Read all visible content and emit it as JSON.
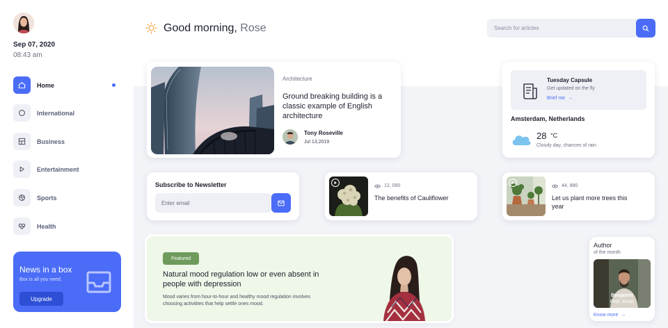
{
  "user": {
    "date": "Sep 07, 2020",
    "time": "08:43 am",
    "greeting": "Good morning,",
    "name": "Rose"
  },
  "sidebar": {
    "items": [
      {
        "label": "Home",
        "icon": "home-icon",
        "active": true
      },
      {
        "label": "International",
        "icon": "circle-icon"
      },
      {
        "label": "Business",
        "icon": "grid-icon"
      },
      {
        "label": "Entertainment",
        "icon": "play-icon"
      },
      {
        "label": "Sports",
        "icon": "ball-icon"
      },
      {
        "label": "Health",
        "icon": "heart-icon"
      }
    ],
    "promo": {
      "title": "News in a box",
      "subtitle": "Box is all you need.",
      "button": "Upgrade"
    }
  },
  "search": {
    "placeholder": "Search for articles"
  },
  "feature": {
    "category": "Architecture",
    "title": "Ground breaking building is a classic example of English architecture",
    "author": "Tony Roseville",
    "date": "Jul 13,2019"
  },
  "capsule": {
    "title": "Tuesday Capsule",
    "subtitle": "Get updated on the fly",
    "link": "Brief me"
  },
  "weather": {
    "city": "Amsterdam, Netherlands",
    "temp": "28",
    "unit": "°C",
    "desc": "Cloudy day, chances of rain"
  },
  "newsletter": {
    "title": "Subscribe to Newsletter",
    "placeholder": "Enter email"
  },
  "videos": [
    {
      "views": "12, 090",
      "title": "The benefits of Cauliflower"
    },
    {
      "views": "44, 880",
      "title": "Let us plant more trees this year"
    }
  ],
  "banner": {
    "badge": "Featured",
    "title": "Natural mood regulation low or even absent in people with depression",
    "desc": "Mood varies from hour-to-hour and healthy mood regulation involves choosing activitites that help settle ones mood."
  },
  "author_of_month": {
    "title": "Author",
    "subtitle": "of the month",
    "first": "Benjamin",
    "last": "Pete Jonas",
    "link": "Know more"
  },
  "colors": {
    "accent": "#4a6cf7",
    "badge": "#6e9b5c",
    "banner_bg": "#eef7e8"
  }
}
